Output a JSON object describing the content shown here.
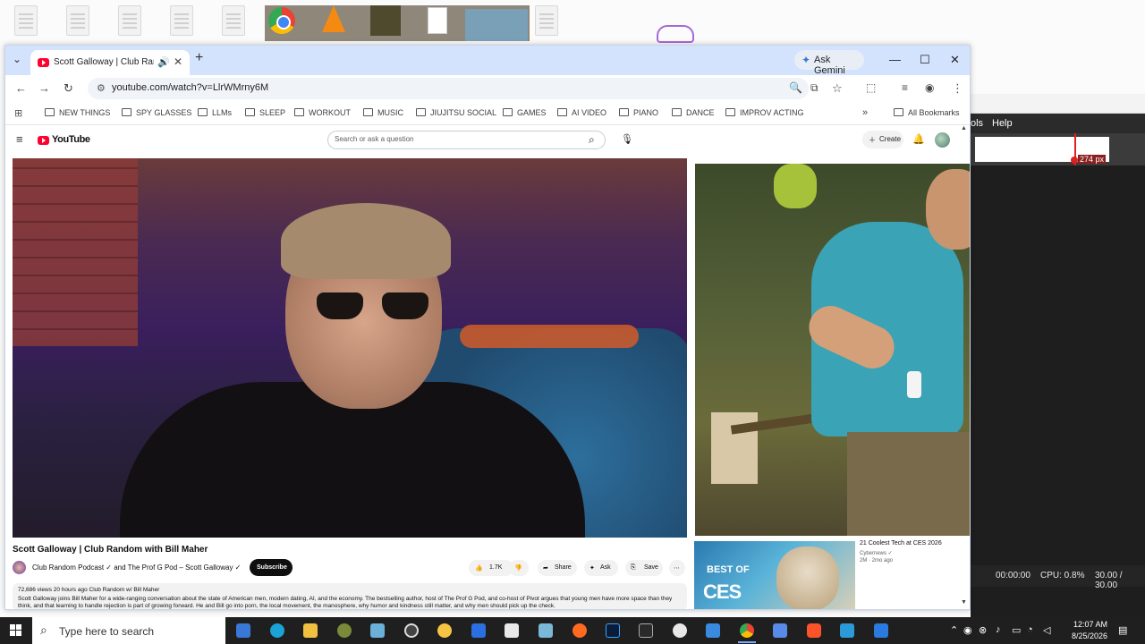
{
  "desktop": {
    "drawing_value": "274 px"
  },
  "bg_app": {
    "menu": [
      "ols",
      "Help"
    ],
    "status": {
      "time": "00:00:00",
      "cpu": "CPU: 0.8%",
      "fps": "30.00 / 30.00"
    }
  },
  "browser": {
    "tab_title": "Scott Galloway | Club Rando",
    "new_tab": "+",
    "gemini_label": "Ask Gemini",
    "url": "youtube.com/watch?v=LlrWMrny6M",
    "bookmarks": [
      "NEW THINGS",
      "SPY GLASSES",
      "LLMs",
      "SLEEP",
      "WORKOUT",
      "MUSIC",
      "JIUJITSU SOCIAL",
      "GAMES",
      "AI VIDEO",
      "PIANO",
      "DANCE",
      "IMPROV ACTING"
    ],
    "all_bookmarks": "All Bookmarks"
  },
  "youtube": {
    "logo_text": "YouTube",
    "search_placeholder": "Search or ask a question",
    "create_label": "Create",
    "video_title": "Scott Galloway | Club Random with Bill Maher",
    "channel_line": "Club Random Podcast ✓ and The Prof G Pod – Scott Galloway ✓",
    "subscribe": "Subscribe",
    "actions": {
      "likes": "1.7K",
      "share": "Share",
      "ask": "Ask",
      "save": "Save"
    },
    "description_meta": "72,686 views  20 hours ago  Club Random w/ Bill Maher",
    "description_text": "Scott Galloway joins Bill Maher for a wide-ranging conversation about the state of American men, modern dating, AI, and the economy. The bestselling author, host of The Prof G Pod, and co-host of Pivot argues that young men have more space than they think, and that learning to handle rejection is part of growing forward. He and Bill go into porn, the local movement, the manosphere, why humor and kindness still matter, and why men should pick up the check.",
    "suggestion": {
      "title": "21 Coolest Tech at CES 2026",
      "channel": "Cybernews ✓",
      "meta": "2M · 2mo ago",
      "thumb_line1": "BEST OF",
      "thumb_line2": "CES"
    }
  },
  "taskbar": {
    "search_placeholder": "Type here to search",
    "time": "12:07 AM",
    "date": "8/25/2026"
  },
  "colors": {
    "youtube_red": "#ff0033",
    "chrome_tabstrip": "#d3e3fd",
    "taskbar": "#1f1f1f"
  }
}
